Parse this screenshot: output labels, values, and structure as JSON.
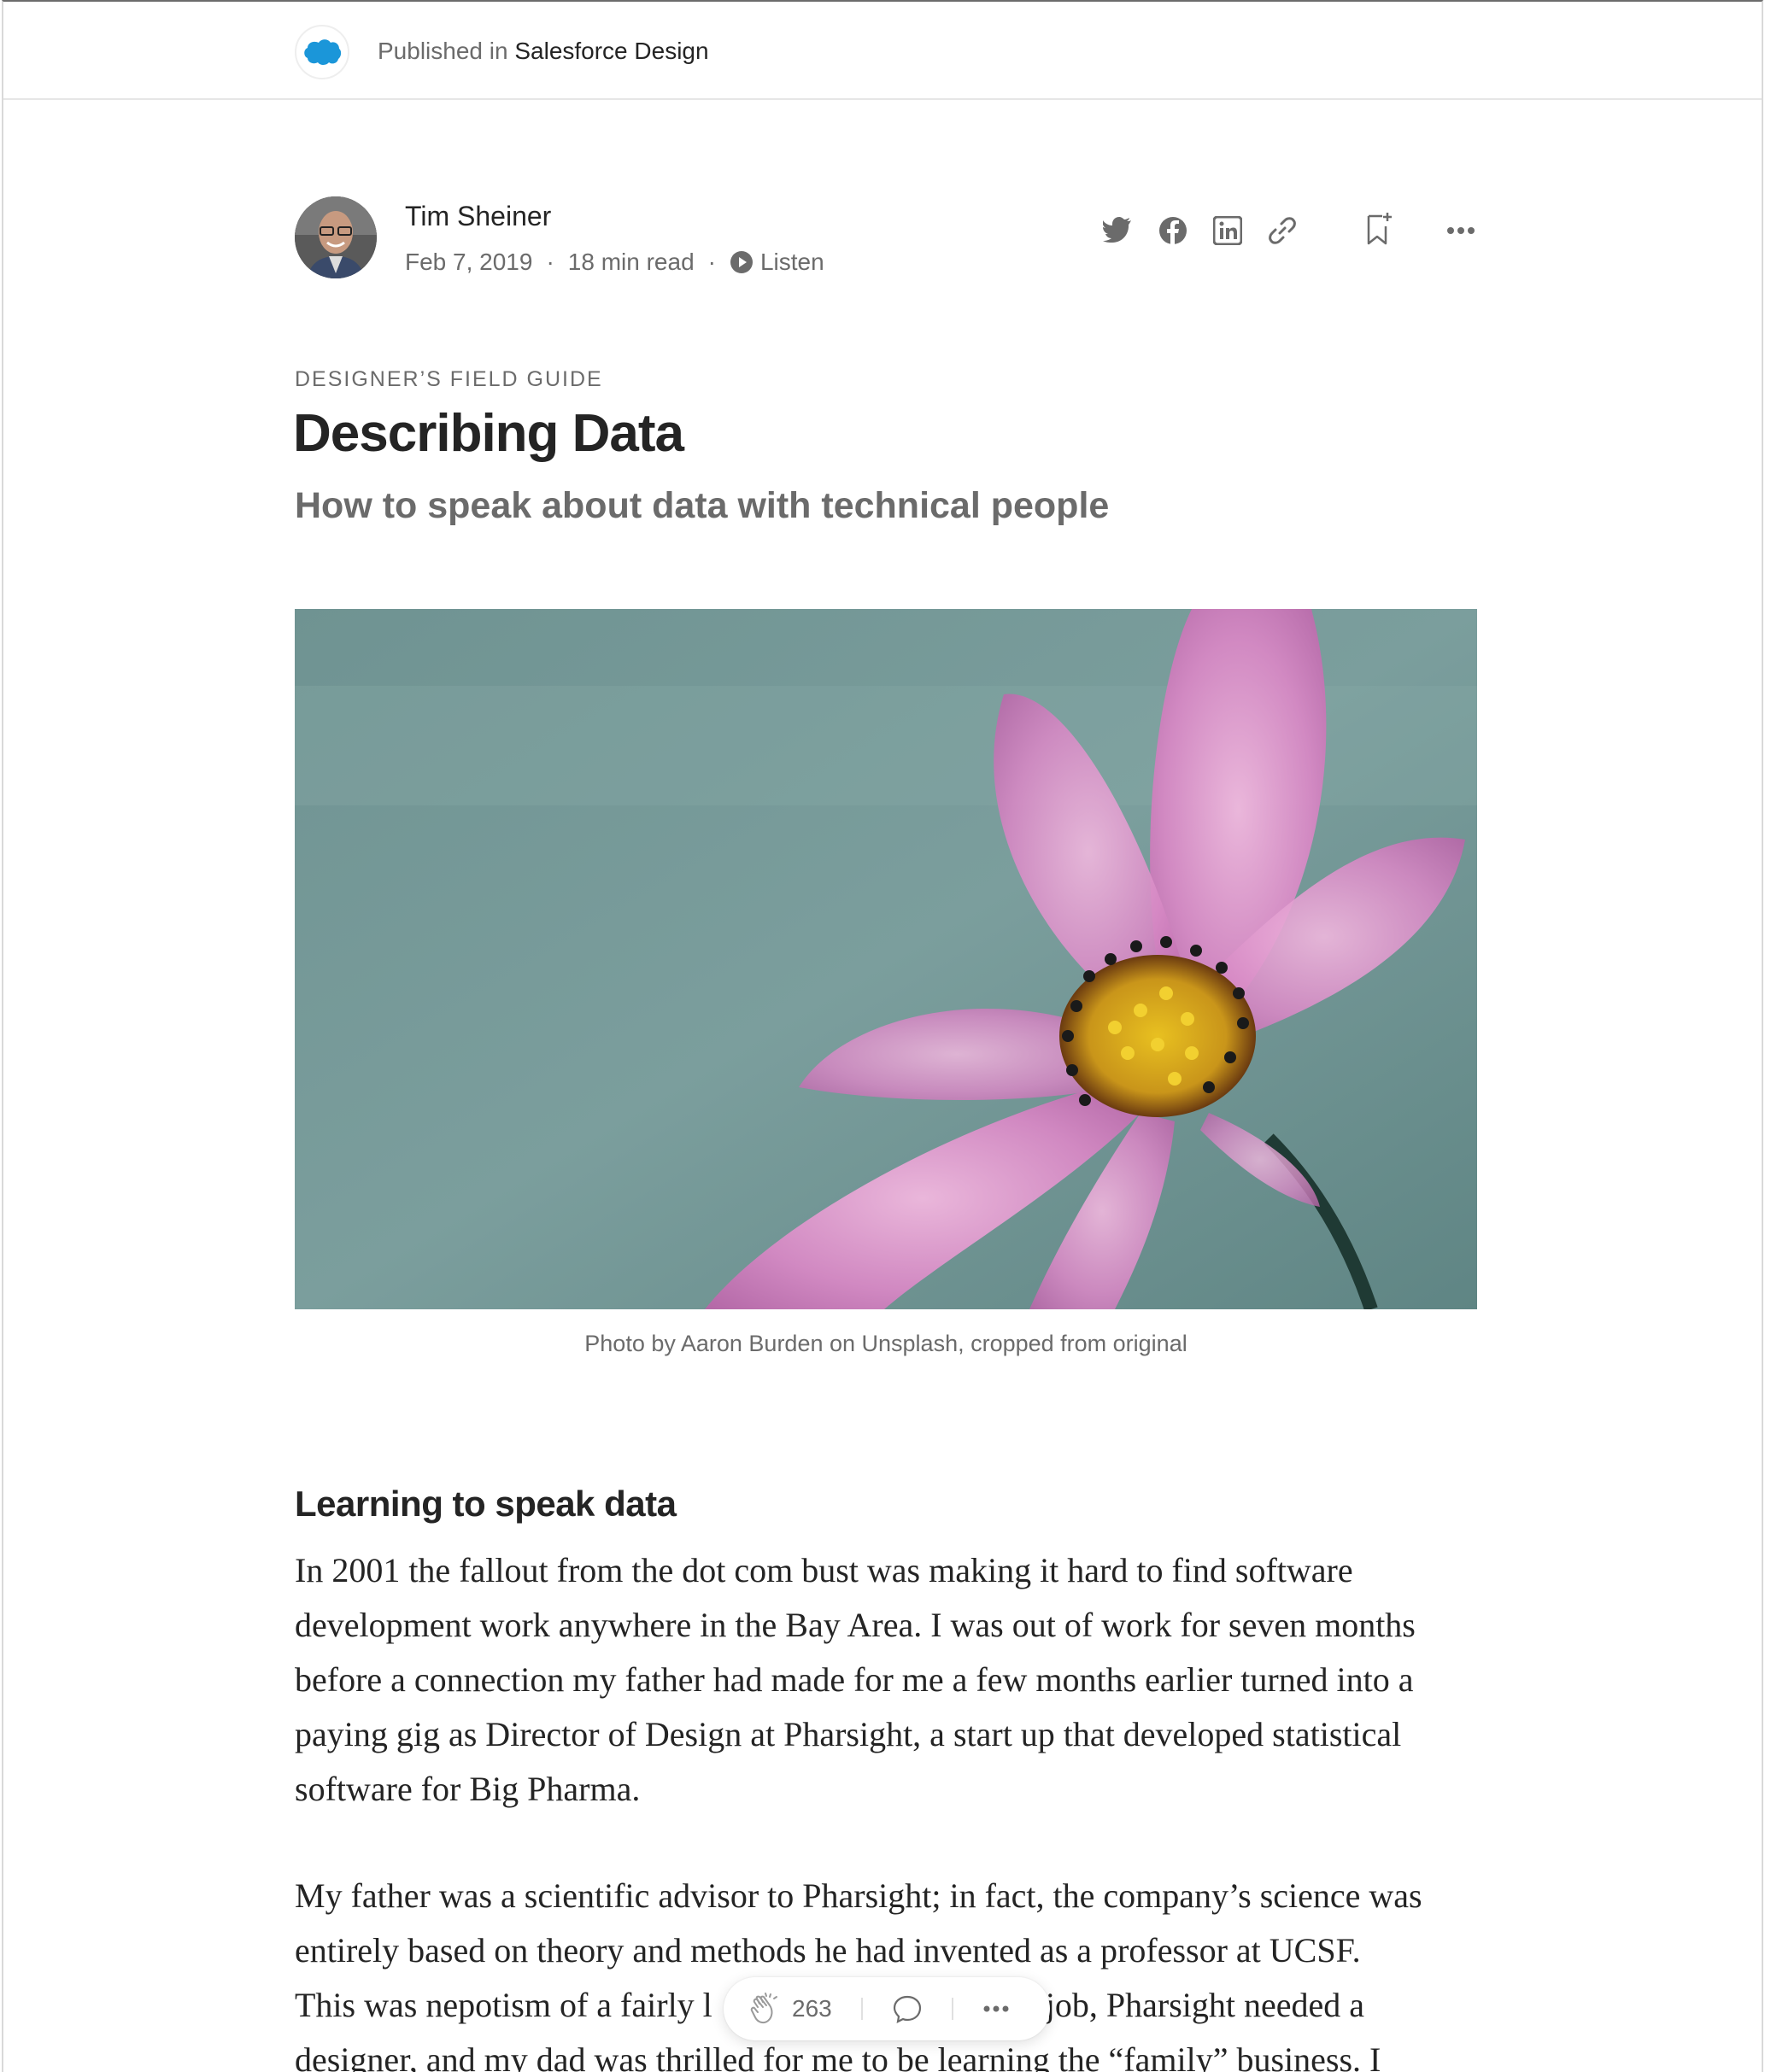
{
  "publication": {
    "prefix": "Published in",
    "name": "Salesforce Design",
    "logo_color": "#1b96d9"
  },
  "author": {
    "name": "Tim Sheiner",
    "date": "Feb 7, 2019",
    "read_time": "18 min read",
    "listen_label": "Listen"
  },
  "share_icons": [
    "twitter-icon",
    "facebook-icon",
    "linkedin-icon",
    "link-icon",
    "bookmark-add-icon",
    "more-icon"
  ],
  "article": {
    "kicker": "DESIGNER’S FIELD GUIDE",
    "title": "Describing Data",
    "subtitle": "How to speak about data with technical people",
    "image_caption": "Photo by Aaron Burden on Unsplash, cropped from original",
    "section_heading": "Learning to speak data",
    "paragraph_1": "In 2001 the fallout from the dot com bust was making it hard to find software development work anywhere in the Bay Area. I was out of work for seven months before a connection my father had made for me a few months earlier turned into a paying gig as Director of Design at Pharsight, a start up that developed statistical software for Big Pharma.",
    "paragraph_2_line_1": "My father was a scientific advisor to Pharsight; in fact, the company’s science was entirely based on theory and methods he had invented as a professor at UCSF.",
    "paragraph_2_line_3_start": "This was nepotism of a fairly l",
    "paragraph_2_line_3_end": "job, Pharsight needed a",
    "paragraph_2_line_4": "designer, and my dad was thrilled for me to be learning the “family” business. I"
  },
  "floating_bar": {
    "clap_count": "263"
  },
  "colors": {
    "text_primary": "#242424",
    "text_secondary": "#6b6b6b",
    "icon_gray": "#6b6b6b"
  }
}
